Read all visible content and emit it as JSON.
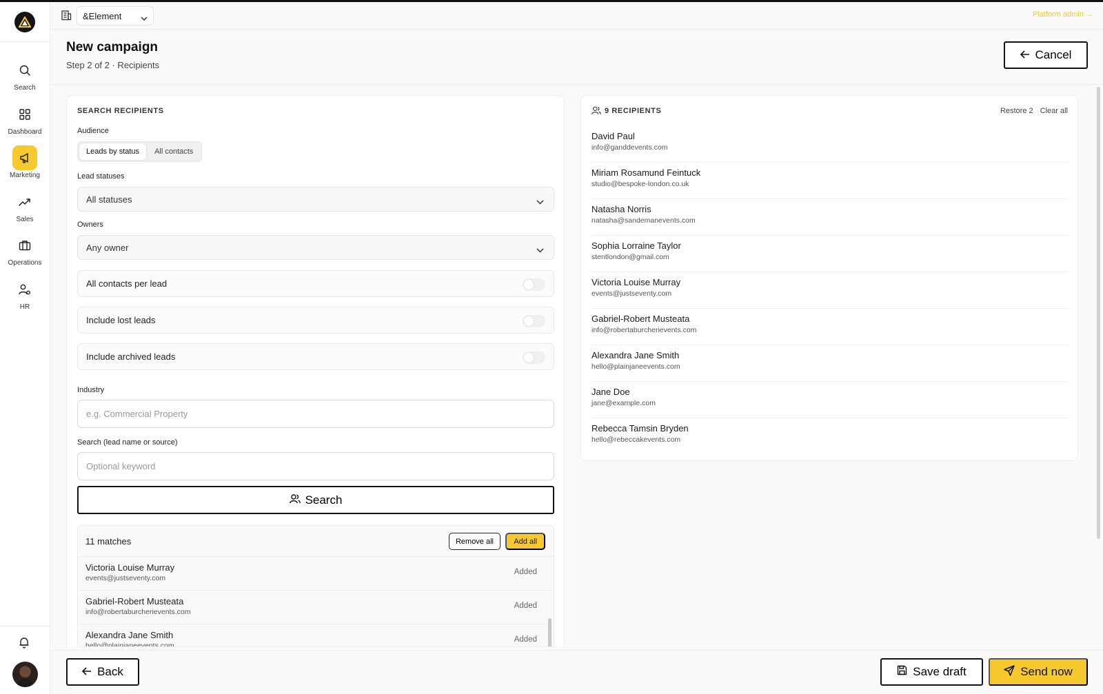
{
  "topbar": {
    "org_name": "&Element",
    "platform_admin": "Platform admin →"
  },
  "sidebar": {
    "items": [
      {
        "label": "Search",
        "icon": "search-icon"
      },
      {
        "label": "Dashboard",
        "icon": "dashboard-icon"
      },
      {
        "label": "Marketing",
        "icon": "megaphone-icon",
        "active": true
      },
      {
        "label": "Sales",
        "icon": "trending-up-icon"
      },
      {
        "label": "Operations",
        "icon": "briefcase-icon"
      },
      {
        "label": "HR",
        "icon": "users-settings-icon"
      }
    ]
  },
  "header": {
    "title": "New campaign",
    "subtitle": "Step 2 of 2 · Recipients",
    "cancel_label": "Cancel"
  },
  "search_panel": {
    "title": "SEARCH RECIPIENTS",
    "audience_label": "Audience",
    "audience_options": [
      "Leads by status",
      "All contacts"
    ],
    "audience_selected": "Leads by status",
    "lead_statuses_label": "Lead statuses",
    "lead_statuses_value": "All statuses",
    "owners_label": "Owners",
    "owners_value": "Any owner",
    "toggles": [
      {
        "label": "All contacts per lead",
        "on": false
      },
      {
        "label": "Include lost leads",
        "on": false
      },
      {
        "label": "Include archived leads",
        "on": false
      }
    ],
    "industry_label": "Industry",
    "industry_placeholder": "e.g. Commercial Property",
    "keyword_label": "Search (lead name or source)",
    "keyword_placeholder": "Optional keyword",
    "search_button": "Search"
  },
  "matches": {
    "count_label": "11 matches",
    "remove_all": "Remove all",
    "add_all": "Add all",
    "rows": [
      {
        "name": "Victoria Louise Murray",
        "email": "events@justseventy.com",
        "status": "Added"
      },
      {
        "name": "Gabriel-Robert Musteata",
        "email": "info@robertaburcherievents.com",
        "status": "Added"
      },
      {
        "name": "Alexandra Jane Smith",
        "email": "hello@plainjaneevents.com",
        "status": "Added"
      }
    ]
  },
  "recipients": {
    "title": "9 RECIPIENTS",
    "restore": "Restore 2",
    "clear_all": "Clear all",
    "list": [
      {
        "name": "David Paul",
        "email": "info@ganddevents.com"
      },
      {
        "name": "Miriam Rosamund Feintuck",
        "email": "studio@bespoke-london.co.uk"
      },
      {
        "name": "Natasha Norris",
        "email": "natasha@sandemanevents.com"
      },
      {
        "name": "Sophia Lorraine Taylor",
        "email": "stentlondon@gmail.com"
      },
      {
        "name": "Victoria Louise Murray",
        "email": "events@justseventy.com"
      },
      {
        "name": "Gabriel-Robert Musteata",
        "email": "info@robertaburcherievents.com"
      },
      {
        "name": "Alexandra Jane Smith",
        "email": "hello@plainjaneevents.com"
      },
      {
        "name": "Jane Doe",
        "email": "jane@example.com"
      },
      {
        "name": "Rebecca Tamsin Bryden",
        "email": "hello@rebeccakevents.com"
      }
    ]
  },
  "footer": {
    "back_label": "Back",
    "save_draft_label": "Save draft",
    "send_now_label": "Send now"
  },
  "colors": {
    "accent": "#f6c92f",
    "platform_admin": "#f0c53a",
    "text": "#1c1c1c"
  }
}
